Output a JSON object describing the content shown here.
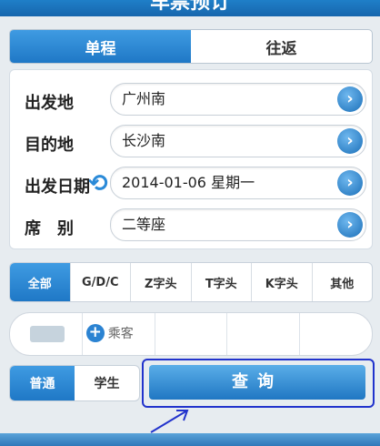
{
  "header": {
    "title": "车票预订"
  },
  "trip_tabs": [
    "单程",
    "往返"
  ],
  "form": {
    "departure_label": "出发地",
    "departure_value": "广州南",
    "destination_label": "目的地",
    "destination_value": "长沙南",
    "date_label": "出发日期",
    "date_value": "2014-01-06 星期一",
    "seat_label": "席　别",
    "seat_value": "二等座"
  },
  "filters": [
    "全部",
    "G/D/C",
    "Z字头",
    "T字头",
    "K字头",
    "其他"
  ],
  "passengers": {
    "add_label": "乘客"
  },
  "passenger_type": [
    "普通",
    "学生"
  ],
  "query_label": "查询",
  "colors": {
    "accent": "#1f78c6",
    "highlight_frame": "#2233cc"
  }
}
